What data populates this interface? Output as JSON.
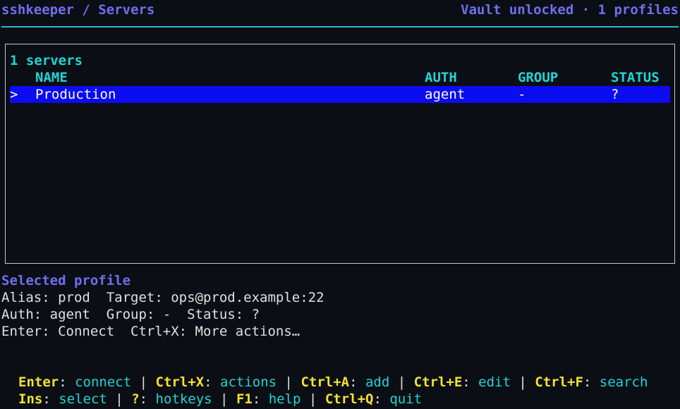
{
  "header": {
    "breadcrumb": "sshkeeper / Servers",
    "status": "Vault unlocked · 1 profiles"
  },
  "list": {
    "count_label": "1 servers",
    "columns": {
      "name": "NAME",
      "auth": "AUTH",
      "group": "GROUP",
      "status": "STATUS"
    },
    "rows": [
      {
        "cursor": ">",
        "name": "Production",
        "auth": "agent",
        "group": "-",
        "status": "?"
      }
    ]
  },
  "details": {
    "heading": "Selected profile",
    "line1": "Alias: prod  Target: ops@prod.example:22",
    "line2": "Auth: agent  Group: -  Status: ?",
    "line3": "Enter: Connect  Ctrl+X: More actions…"
  },
  "hotkeys": {
    "sep": " | ",
    "enter_key": "Enter",
    "enter_desc": "connect",
    "ctrlx_key": "Ctrl+X",
    "ctrlx_desc": "actions",
    "ctrla_key": "Ctrl+A",
    "ctrla_desc": "add",
    "ctrle_key": "Ctrl+E",
    "ctrle_desc": "edit",
    "ctrlf_key": "Ctrl+F",
    "ctrlf_desc": "search",
    "ins_key": "Ins",
    "ins_desc": "select",
    "q_key": "?",
    "q_desc": "hotkeys",
    "f1_key": "F1",
    "f1_desc": "help",
    "ctrlq_key": "Ctrl+Q",
    "ctrlq_desc": "quit"
  },
  "colors": {
    "background": "#0b0e14",
    "title": "#6f6ff0",
    "accent_cyan": "#1fd6d6",
    "hotkey_yellow": "#f2e233",
    "selection": "#0c0cf0"
  }
}
